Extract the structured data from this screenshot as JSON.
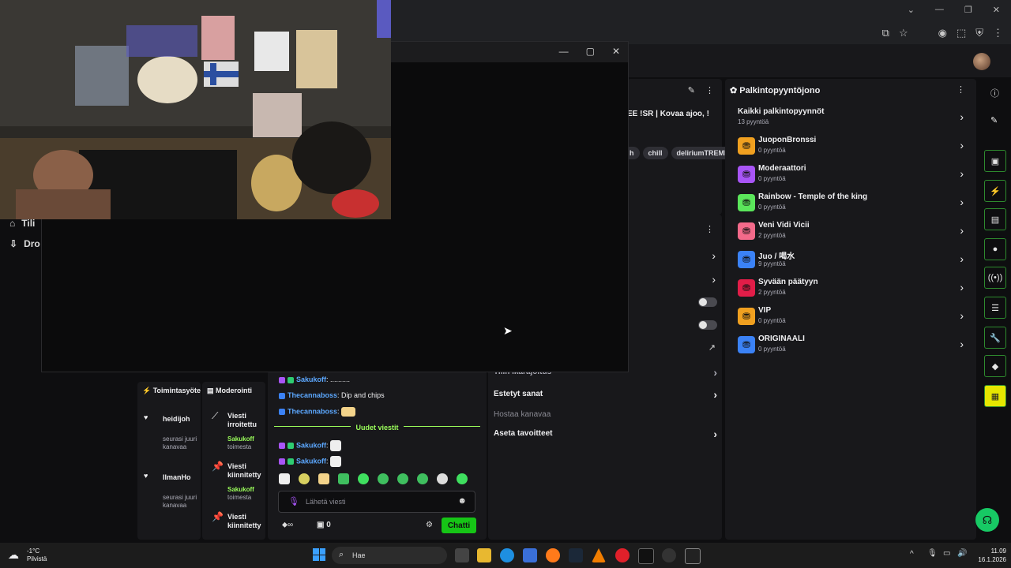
{
  "rewards": {
    "header": "Palkintopyyntöjono",
    "all": {
      "title": "Kaikki palkintopyynnöt",
      "count": "13 pyyntöä"
    },
    "items": [
      {
        "title": "JuoponBronssi",
        "count": "0 pyyntöä",
        "color": "#f0a020"
      },
      {
        "title": "Moderaattori",
        "count": "0 pyyntöä",
        "color": "#a855f7"
      },
      {
        "title": "Rainbow - Temple of the king",
        "count": "0 pyyntöä",
        "color": "#5be65b"
      },
      {
        "title": "Veni Vidi Vicii",
        "count": "2 pyyntöä",
        "color": "#f36a8a"
      },
      {
        "title": "Juo / 喝水",
        "count": "9 pyyntöä",
        "color": "#3b82f6"
      },
      {
        "title": "Syvään päätyyn",
        "count": "2 pyyntöä",
        "color": "#e11d48"
      },
      {
        "title": "VIP",
        "count": "0 pyyntöä",
        "color": "#f0a020"
      },
      {
        "title": "ORIGINAALI",
        "count": "0 pyyntöä",
        "color": "#3b82f6"
      }
    ]
  },
  "stream": {
    "title_fragment": "EE !SR | Kovaa ajoo, !",
    "tags": [
      "h",
      "chill",
      "deliriumTREME"
    ]
  },
  "settings": {
    "rows": [
      "Tilin ikärajoitus",
      "Estetyt sanat",
      "Hostaa kanavaa",
      "Aseta tavoitteet"
    ]
  },
  "leftnav": {
    "items": [
      "Tili",
      "Dro"
    ]
  },
  "activity": {
    "header": "Toimintasyöte",
    "items": [
      {
        "name": "heidijoh",
        "desc": "seurasi juuri kanavaa"
      },
      {
        "name": "IlmanHo",
        "desc": "seurasi juuri kanavaa"
      }
    ]
  },
  "moderation": {
    "header": "Moderointi",
    "items": [
      {
        "action": "Viesti irroitettu",
        "by": "Sakukoff",
        "suffix": "toimesta"
      },
      {
        "action": "Viesti kiinnitetty",
        "by": "Sakukoff",
        "suffix": "toimesta"
      },
      {
        "action": "Viesti kiinnitetty",
        "by": "",
        "suffix": ""
      }
    ]
  },
  "chat": {
    "messages": [
      {
        "user": "Sakukoff",
        "text": "..........",
        "color": "#5ca8ff"
      },
      {
        "user": "Thecannaboss",
        "text": "Dip and chips",
        "color": "#5ca8ff"
      },
      {
        "user": "Thecannaboss",
        "text": "",
        "color": "#5ca8ff"
      }
    ],
    "divider": "Uudet viestit",
    "new_messages": [
      {
        "user": "Sakukoff",
        "text": ""
      },
      {
        "user": "Sakukoff",
        "text": ""
      }
    ],
    "input_placeholder": "Lähetä viesti",
    "points": "0",
    "send_label": "Chatti"
  },
  "taskbar": {
    "weather_temp": "-1°C",
    "weather_desc": "Pilvistä",
    "search_placeholder": "Hae",
    "time": "11.09",
    "date": "16.1.2026"
  }
}
